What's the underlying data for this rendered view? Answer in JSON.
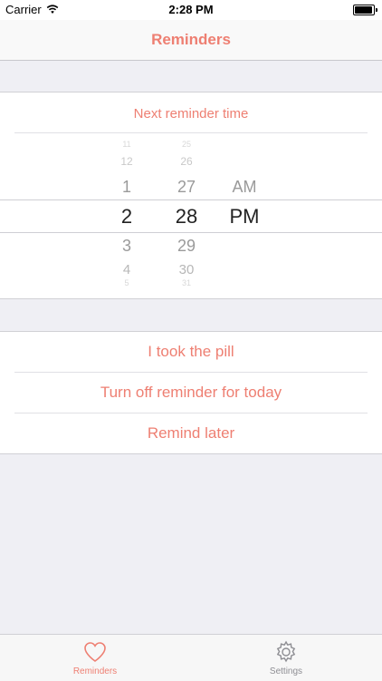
{
  "status": {
    "carrier": "Carrier",
    "time": "2:28 PM"
  },
  "nav": {
    "title": "Reminders"
  },
  "reminder": {
    "title": "Next reminder time",
    "picker": {
      "hours": [
        "11",
        "12",
        "1",
        "2",
        "3",
        "4",
        "5"
      ],
      "minutes": [
        "25",
        "26",
        "27",
        "28",
        "29",
        "30",
        "31"
      ],
      "ampm": [
        "AM",
        "PM"
      ],
      "selected": {
        "hour": "2",
        "minute": "28",
        "ampm": "PM"
      }
    }
  },
  "actions": [
    {
      "label": "I took the pill"
    },
    {
      "label": "Turn off reminder for today"
    },
    {
      "label": "Remind later"
    }
  ],
  "tabs": [
    {
      "label": "Reminders",
      "active": true
    },
    {
      "label": "Settings",
      "active": false
    }
  ],
  "colors": {
    "accent": "#ee7f72",
    "background": "#efeff4"
  }
}
